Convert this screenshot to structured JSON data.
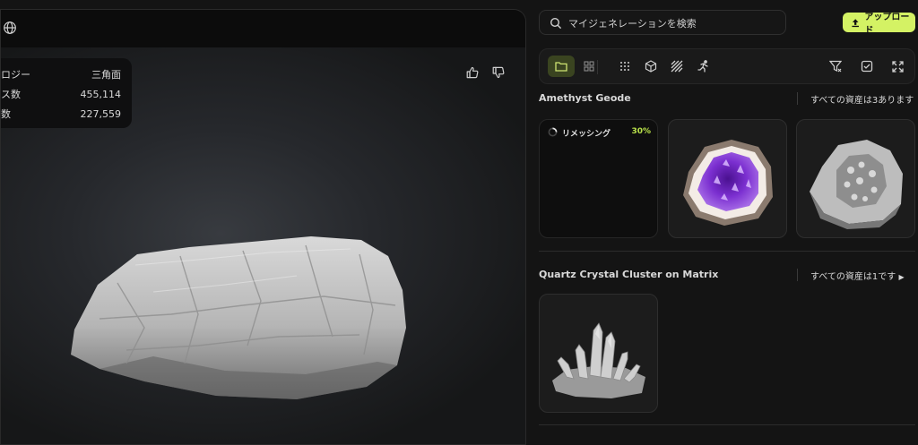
{
  "viewport": {
    "stats": [
      {
        "label": "ロジー",
        "value": "三角面"
      },
      {
        "label": "ス数",
        "value": "455,114"
      },
      {
        "label": "数",
        "value": "227,559"
      }
    ],
    "icons": [
      "globe-icon",
      "thumbs-up-icon",
      "thumbs-down-icon"
    ]
  },
  "search": {
    "placeholder": "マイジェネレーションを検索"
  },
  "upload": {
    "label": "アップロード"
  },
  "toolbar": {
    "icons": [
      "folder-icon",
      "grid-icon",
      "dots-grid-icon",
      "cube-icon",
      "texture-icon",
      "running-icon",
      "filter-icon",
      "checkbox-icon",
      "expand-icon"
    ]
  },
  "sections": [
    {
      "title": "Amethyst Geode",
      "link": "すべての資産は3あります",
      "cards": [
        {
          "type": "progress",
          "label": "リメッシング",
          "percent": "30%"
        },
        {
          "type": "image",
          "icon": "amethyst-geode-thumbnail"
        },
        {
          "type": "image",
          "icon": "geode-gray-thumbnail"
        }
      ]
    },
    {
      "title": "Quartz Crystal Cluster on Matrix",
      "link": "すべての資産は1です",
      "cards": [
        {
          "type": "image",
          "icon": "quartz-cluster-thumbnail"
        }
      ]
    }
  ],
  "colors": {
    "accent": "#d4f264",
    "progress": "#b8e04a",
    "amethyst": "#7b2fd0"
  }
}
